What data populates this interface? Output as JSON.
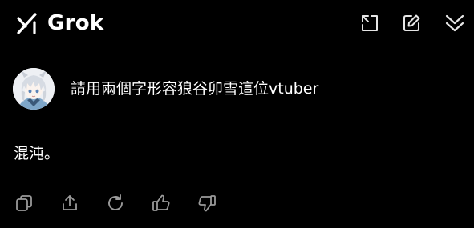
{
  "header": {
    "app_name": "Grok",
    "icons": [
      "grok-logo-icon",
      "expand-icon",
      "edit-icon",
      "collapse-icon"
    ]
  },
  "conversation": {
    "user_message": "請用兩個字形容狼谷卯雪這位vtuber",
    "assistant_reply": "混沌。"
  },
  "actions": {
    "icons": [
      "copy-icon",
      "share-icon",
      "regenerate-icon",
      "thumbs-up-icon",
      "thumbs-down-icon"
    ]
  },
  "colors": {
    "background": "#000000",
    "text": "#ffffff",
    "icon": "#e6e6e6",
    "action_icon": "#9a9a9a"
  }
}
